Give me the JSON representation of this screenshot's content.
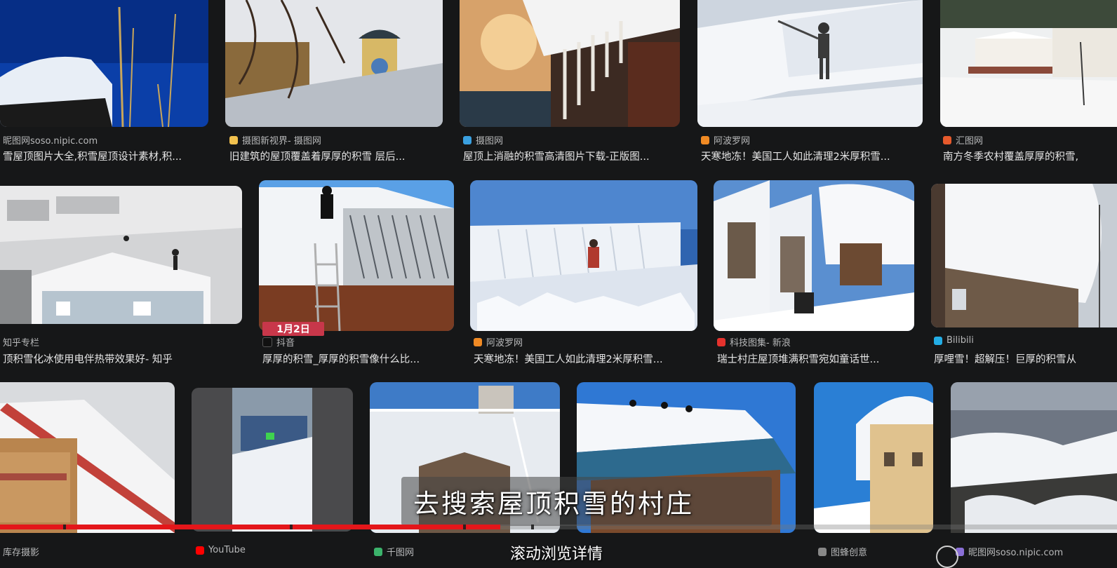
{
  "results": [
    {
      "source": "昵图网soso.nipic.com",
      "title": "雪屋顶图片大全,积雪屋顶设计素材,积...",
      "favicon_color": "#d9d9d9"
    },
    {
      "source": "摄图新视界- 摄图网",
      "title": "旧建筑的屋顶覆盖着厚厚的积雪 层后...",
      "favicon_color": "#f2c14e"
    },
    {
      "source": "摄图网",
      "title": "屋顶上消融的积雪高清图片下载-正版图...",
      "favicon_color": "#3aa0e0"
    },
    {
      "source": "阿波罗网",
      "title": "天寒地冻！美国工人如此清理2米厚积雪...",
      "favicon_color": "#f08a24"
    },
    {
      "source": "汇图网",
      "title": "南方冬季农村覆盖厚厚的积雪,",
      "favicon_color": "#e65a2c"
    },
    {
      "source": "知乎专栏",
      "title": "顶积雪化冰使用电伴热带效果好- 知乎",
      "favicon_color": "#1e6fe0"
    },
    {
      "source": "抖音",
      "title": "厚厚的积雪_厚厚的积雪像什么比...",
      "favicon_color": "#111111",
      "badge": "1月2日"
    },
    {
      "source": "阿波罗网",
      "title": "天寒地冻！美国工人如此清理2米厚积雪...",
      "favicon_color": "#f08a24"
    },
    {
      "source": "科技图集- 新浪",
      "title": "瑞士村庄屋顶堆满积雪宛如童话世...",
      "favicon_color": "#e5322d"
    },
    {
      "source": "Bilibili",
      "title": "厚哩雪！超解压！巨厚的积雪从",
      "favicon_color": "#23ade5"
    }
  ],
  "bottom_row": [
    {
      "source": "库存摄影"
    },
    {
      "source": "YouTube",
      "favicon_color": "#ff0000"
    },
    {
      "source": "千图网",
      "favicon_color": "#3bb36b"
    },
    {
      "source": "图蜂创意",
      "favicon_color": "#888888"
    },
    {
      "source": "昵图网soso.nipic.com",
      "favicon_color": "#8a6fd6"
    }
  ],
  "subtitle": "去搜索屋顶积雪的村庄",
  "bottom_caption": "滚动浏览详情",
  "progress": {
    "fraction": 0.448
  }
}
